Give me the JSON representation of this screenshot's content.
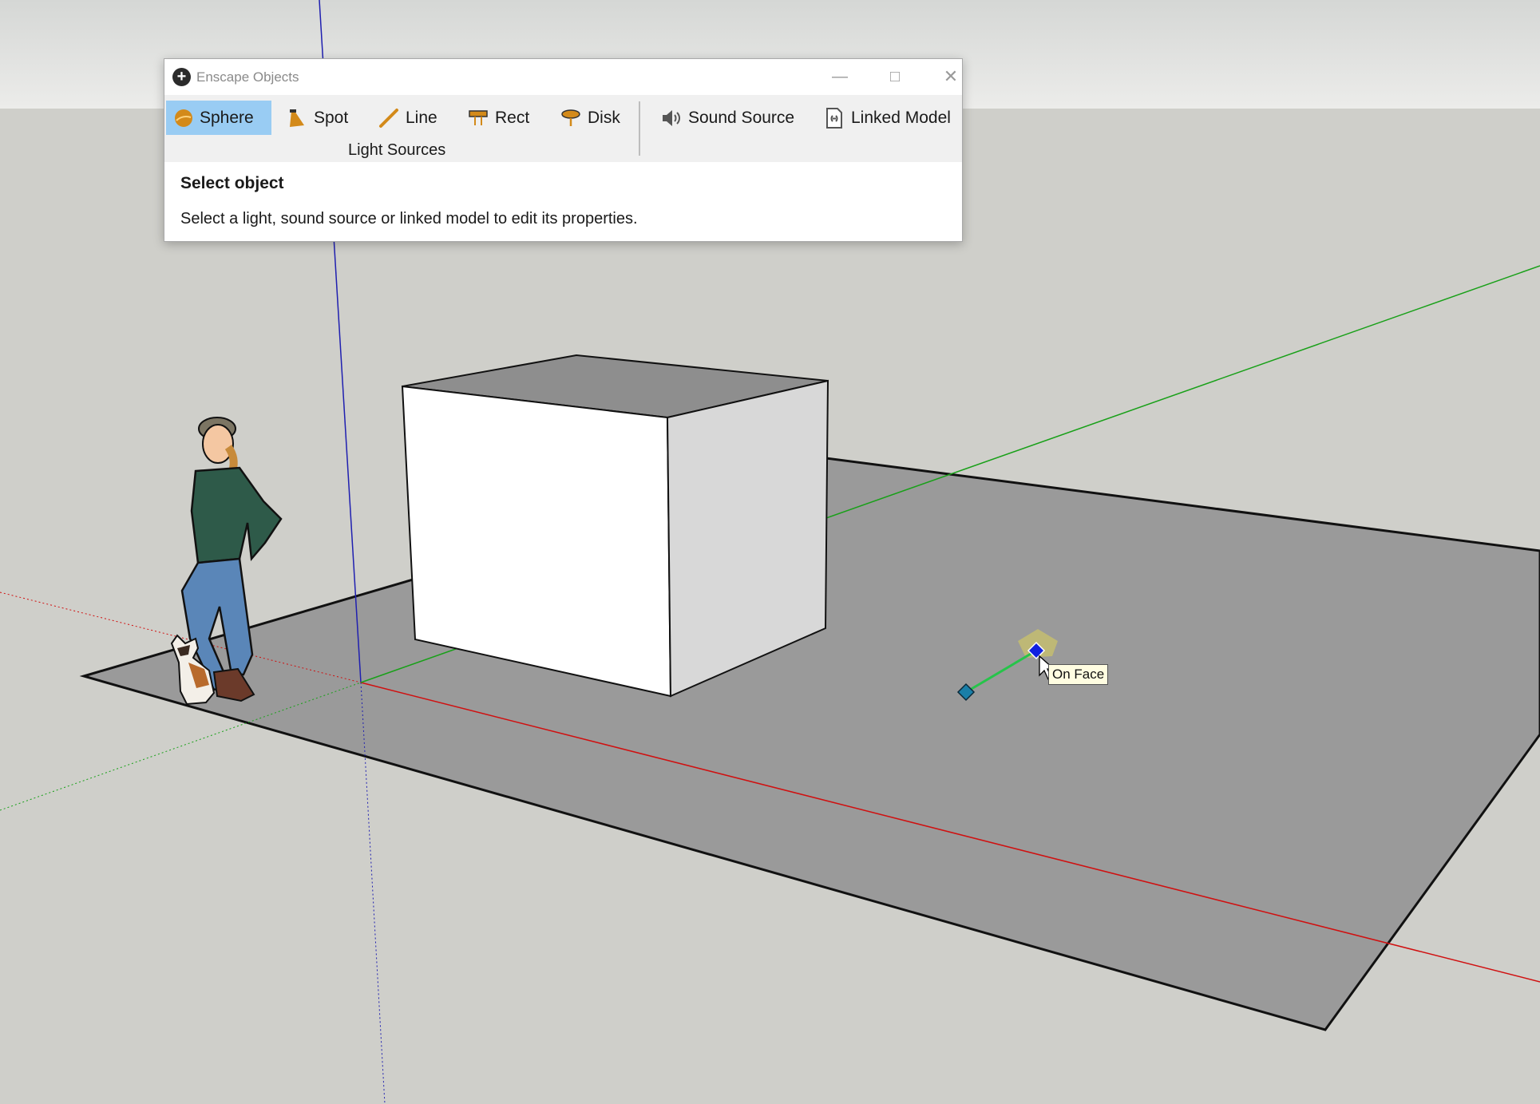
{
  "window": {
    "title": "Enscape Objects",
    "icon": "plus-circle-icon"
  },
  "toolbar": {
    "sphere_label": "Sphere",
    "spot_label": "Spot",
    "line_label": "Line",
    "rect_label": "Rect",
    "disk_label": "Disk",
    "light_sources_label": "Light Sources",
    "sound_source_label": "Sound Source",
    "linked_model_label": "Linked Model",
    "active_tool": "Sphere",
    "accent_color": "#99ccf3",
    "icon_color": "#d38a1a"
  },
  "panel": {
    "title": "Select object",
    "description": "Select a light, sound source or linked model to edit its properties."
  },
  "viewport": {
    "tooltip": "On Face",
    "sky_color": "#e6e7e6",
    "ground_color": "#cfcfca",
    "plane_color": "#9a9a9a"
  }
}
